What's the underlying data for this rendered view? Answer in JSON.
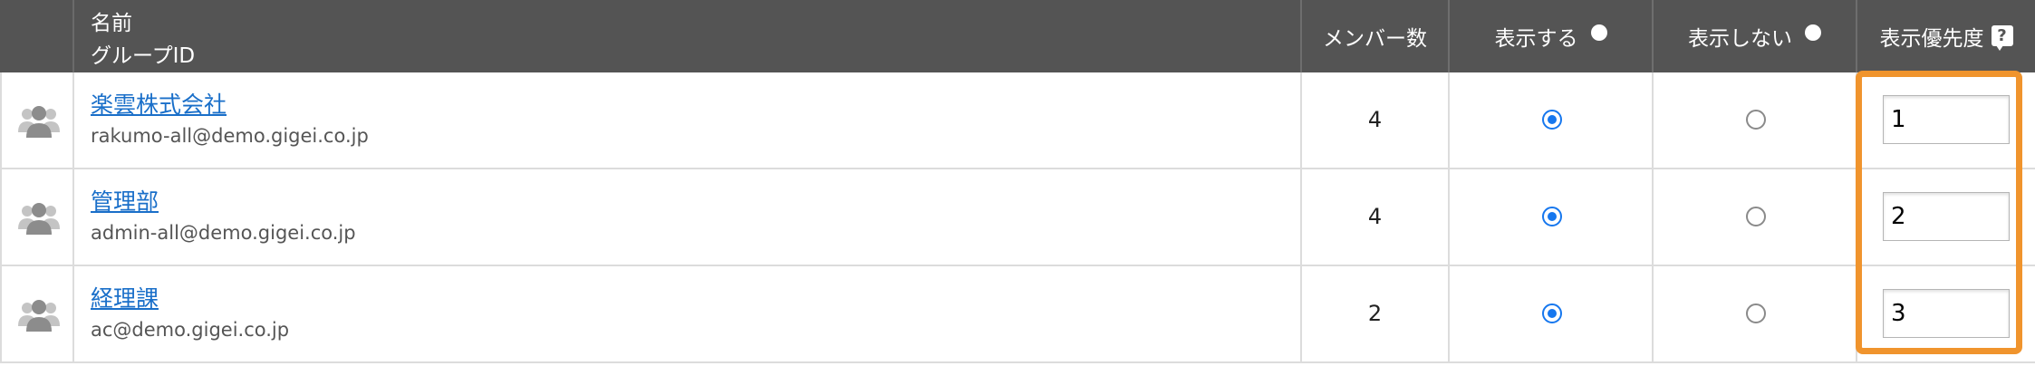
{
  "header": {
    "name_label": "名前",
    "group_id_label": "グループID",
    "member_count_label": "メンバー数",
    "show_label": "表示する",
    "hide_label": "表示しない",
    "priority_label": "表示優先度",
    "help_icon_text": "?"
  },
  "colors": {
    "header_bg": "#545454",
    "link": "#1a6fc9",
    "radio_checked": "#1677ee",
    "highlight": "#f0942d"
  },
  "icons": {
    "group": "group-icon",
    "help": "help-icon"
  },
  "rows": [
    {
      "name": "楽雲株式会社",
      "group_id": "rakumo-all@demo.gigei.co.jp",
      "member_count": "4",
      "visibility": "show",
      "priority": "1"
    },
    {
      "name": "管理部",
      "group_id": "admin-all@demo.gigei.co.jp",
      "member_count": "4",
      "visibility": "show",
      "priority": "2"
    },
    {
      "name": "経理課",
      "group_id": "ac@demo.gigei.co.jp",
      "member_count": "2",
      "visibility": "show",
      "priority": "3"
    }
  ]
}
